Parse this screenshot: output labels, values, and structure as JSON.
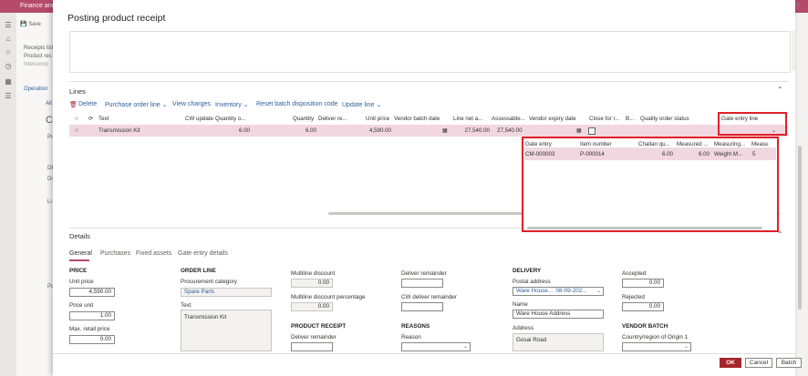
{
  "background_app": {
    "title": "Finance and",
    "save_label": "Save",
    "panel_items": [
      "Receipts list",
      "Product rec",
      "Intercomp"
    ],
    "operations_label": "Operation",
    "all_label": "All",
    "cm_label": "CM",
    "letters": [
      "Pu",
      "DE",
      "Di",
      "Li",
      "Pu"
    ]
  },
  "dialog": {
    "title": "Posting product receipt",
    "help": "?"
  },
  "lines": {
    "section_title": "Lines",
    "toolbar": {
      "delete": "Delete",
      "purchase_order_line": "Purchase order line",
      "view_charges": "View charges",
      "inventory": "Inventory",
      "reset_batch": "Reset batch disposition code",
      "update_line": "Update line"
    },
    "columns": [
      "Text",
      "CW update",
      "Quantity o...",
      "Quantity",
      "Deliver re...",
      "Unit price",
      "Vendor batch date",
      "Line net a...",
      "Assessable...",
      "Vendor expiry date",
      "Close for r...",
      "B...",
      "Quality order status",
      "Gate entry line"
    ],
    "row": {
      "text": "Transmission Kit",
      "quantity_o": "6.00",
      "quantity": "6.00",
      "unit_price": "4,590.00",
      "line_net": "27,540.00",
      "assessable": "27,540.00"
    }
  },
  "gate_entry_dropdown": {
    "columns": [
      "Gate entry",
      "Item number",
      "Challan qu...",
      "Measured ...",
      "Measuring...",
      "Measu"
    ],
    "row": {
      "gate_entry": "CM-000003",
      "item_number": "P-000014",
      "challan_qty": "6.00",
      "measured": "6.00",
      "measuring": "Weight M...",
      "measu": "5"
    }
  },
  "details": {
    "section_title": "Details",
    "tabs": [
      "General",
      "Purchases",
      "Fixed assets",
      "Gate entry details"
    ],
    "price": {
      "heading": "PRICE",
      "unit_price_label": "Unit price",
      "unit_price": "4,590.00",
      "price_unit_label": "Price unit",
      "price_unit": "1.00",
      "max_retail_label": "Max. retail price",
      "max_retail": "0.00"
    },
    "order_line": {
      "heading": "ORDER LINE",
      "proc_cat_label": "Procurement category",
      "proc_cat": "Spare Parts",
      "text_label": "Text",
      "text": "Transmission Kit"
    },
    "discount": {
      "multiline_label": "Multiline discount",
      "multiline": "0.00",
      "multiline_pct_label": "Multiline discount percentage",
      "multiline_pct": "0.00"
    },
    "product_receipt": {
      "heading": "PRODUCT RECEIPT",
      "deliver_remainder_label": "Deliver remainder"
    },
    "remainder": {
      "deliver_remainder_label": "Deliver remainder",
      "cw_deliver_remainder_label": "CW deliver remainder"
    },
    "reasons": {
      "heading": "REASONS",
      "reason_label": "Reason"
    },
    "delivery": {
      "heading": "DELIVERY",
      "postal_label": "Postal address",
      "postal_name": "Ware House...",
      "postal_date": "08-09-202...",
      "name_label": "Name",
      "name": "Ware House Address",
      "address_label": "Address",
      "address_line1": "Gosai Road"
    },
    "accepted": {
      "accepted_label": "Accepted",
      "accepted": "0.00",
      "rejected_label": "Rejected",
      "rejected": "0.00"
    },
    "vendor_batch": {
      "heading": "VENDOR BATCH",
      "country_label": "Country/region of Origin 1"
    }
  },
  "footer": {
    "ok": "OK",
    "cancel": "Cancel",
    "batch": "Batch"
  },
  "colors": {
    "accent": "#b54a6b",
    "selected_row": "#f1d7e0",
    "highlight_box": "#e0202a",
    "link": "#2c5f9e",
    "primary_button": "#a4262c"
  }
}
